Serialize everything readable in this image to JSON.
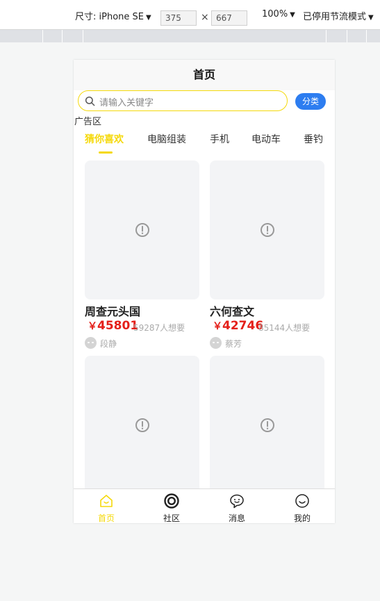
{
  "devtools": {
    "size_label": "尺寸: iPhone SE",
    "width": "375",
    "height": "667",
    "times": "×",
    "zoom": "100%",
    "throttle": "已停用节流模式"
  },
  "app": {
    "title": "首页",
    "search": {
      "placeholder": "请输入关键字"
    },
    "category_button": "分类",
    "ad_zone": "广告区",
    "tabs": [
      {
        "label": "猜你喜欢",
        "active": true
      },
      {
        "label": "电脑组装"
      },
      {
        "label": "手机"
      },
      {
        "label": "电动车"
      },
      {
        "label": "垂钓"
      }
    ],
    "products": [
      {
        "name": "周查元头国",
        "currency": "￥",
        "price": "45801",
        "want": "59287人想要",
        "seller": "段静"
      },
      {
        "name": "六何查文",
        "currency": "￥",
        "price": "42746",
        "want": "85144人想要",
        "seller": "蔡芳"
      },
      {
        "name": "",
        "currency": "",
        "price": "",
        "want": "",
        "seller": ""
      },
      {
        "name": "",
        "currency": "",
        "price": "",
        "want": "",
        "seller": ""
      }
    ],
    "tabbar": [
      {
        "label": "首页",
        "icon": "home-icon",
        "active": true
      },
      {
        "label": "社区",
        "icon": "community-icon"
      },
      {
        "label": "消息",
        "icon": "message-icon"
      },
      {
        "label": "我的",
        "icon": "profile-icon"
      }
    ],
    "colors": {
      "accent": "#f5d90a",
      "button": "#2d7df0",
      "price": "#e41f19"
    }
  }
}
